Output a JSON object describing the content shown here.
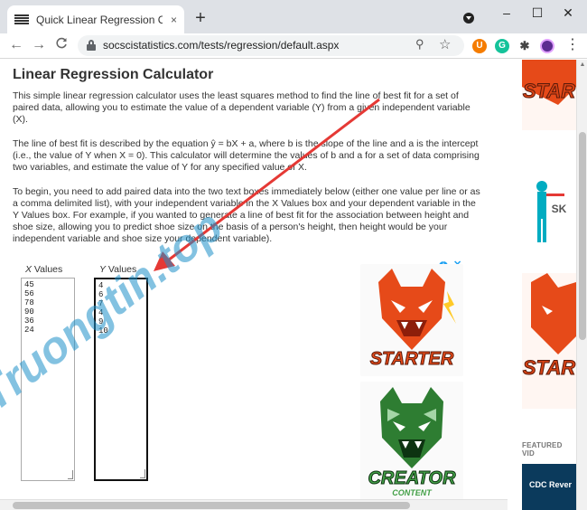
{
  "browser": {
    "tab_title": "Quick Linear Regression Calculat",
    "tab_close": "×",
    "new_tab": "+",
    "url": "socscistatistics.com/tests/regression/default.aspx",
    "win_minimize": "–",
    "win_maximize": "☐",
    "win_close": "✕",
    "back": "←",
    "forward": "→",
    "reload": "C",
    "zoom_glyph": "⚲",
    "star_glyph": "☆",
    "menu_glyph": "⋮",
    "ext_letters": {
      "ext_u": "U",
      "ext_g": "G",
      "ext_puzzle": "✱"
    }
  },
  "page": {
    "title": "Linear Regression Calculator",
    "intro": "This simple linear regression calculator uses the least squares method to find the line of best fit for a set of paired data, allowing you to estimate the value of a dependent variable (Y) from a given independent variable (X).",
    "equation_para": "The line of best fit is described by the equation ŷ = bX + a, where b is the slope of the line and a is the intercept (i.e., the value of Y when X = 0). This calculator will determine the values of b and a for a set of data comprising two variables, and estimate the value of Y for any specified value of X.",
    "instructions": "To begin, you need to add paired data into the two text boxes immediately below (either one value per line or as a comma delimited list), with your independent variable in the X Values box and your dependent variable in the Y Values box. For example, if you wanted to generate a line of best fit for the association between height and shoe size, allowing you to predict shoe size on the basis of a person's height, then height would be your independent variable and shoe size your dependent variable).",
    "x_label_letter": "X",
    "x_label_rest": " Values",
    "y_label_letter": "Y",
    "y_label_rest": " Values",
    "x_values": [
      "45",
      "56",
      "78",
      "90",
      "36",
      "24"
    ],
    "y_values": [
      "4",
      "6",
      "7",
      "4",
      "9",
      "10"
    ]
  },
  "ads": {
    "adchoices": "i",
    "close": "✕",
    "ad1_text": "STARTER",
    "ad2_text": "CREATOR",
    "ad2_sub": "CONTENT"
  },
  "sidebar": {
    "card1_text": "STAR",
    "card2_text": "SK",
    "card3_text": "STAR",
    "featured_label": "FEATURED VID",
    "video_title": "CDC Rever"
  },
  "watermark": "Truongtin.top",
  "colors": {
    "arrow": "#e53935",
    "accent_blue": "#1da1f2",
    "starter_orange": "#e64a19",
    "creator_green": "#2e7d32"
  }
}
